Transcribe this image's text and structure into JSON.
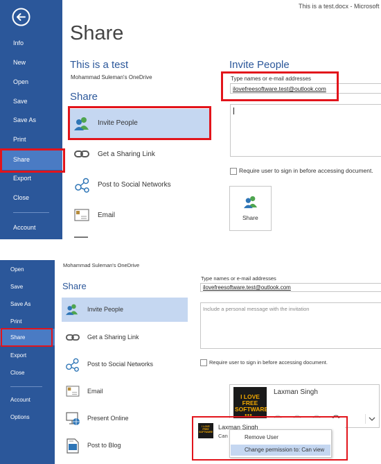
{
  "top": {
    "window_title": "This is a test.docx - Microsoft W",
    "back_icon": "back-arrow-icon",
    "nav": [
      "Info",
      "New",
      "Open",
      "Save",
      "Save As",
      "Print",
      "Share",
      "Export",
      "Close",
      "Account"
    ],
    "active_nav": "Share",
    "page_heading": "Share",
    "doc_title": "This is a test",
    "doc_location": "Mohammad Suleman's OneDrive",
    "share_section": "Share",
    "options": [
      "Invite People",
      "Get a Sharing Link",
      "Post to Social Networks",
      "Email"
    ],
    "selected_option": "Invite People",
    "invite_heading": "Invite People",
    "names_label": "Type names or e-mail addresses",
    "names_value": "ilovefreesoftware.test@outlook.com",
    "require_signin_label": "Require user to sign in before accessing document.",
    "share_button_label": "Share"
  },
  "bottom": {
    "nav": [
      "Open",
      "Save",
      "Save As",
      "Print",
      "Share",
      "Export",
      "Close",
      "Account",
      "Options"
    ],
    "active_nav": "Share",
    "doc_location": "Mohammad Suleman's OneDrive",
    "share_section": "Share",
    "options": [
      "Invite People",
      "Get a Sharing Link",
      "Post to Social Networks",
      "Email",
      "Present Online",
      "Post to Blog"
    ],
    "selected_option": "Invite People",
    "names_label": "Type names or e-mail addresses",
    "names_value": "ilovefreesoftware.test@outlook.com",
    "message_placeholder": "Include a personal message with the invitation",
    "require_signin_label": "Require user to sign in before accessing document.",
    "contact_card_name": "Laxman Singh",
    "contact_row_name": "Laxman Singh",
    "contact_row_sub": "Can",
    "avatar_text": "I LOVE FREE SOFTWARE",
    "context_menu": [
      "Remove User",
      "Change permission to: Can view"
    ]
  },
  "colors": {
    "sidebar": "#2b579a",
    "active_nav": "#4a7bc4",
    "accent": "#2b579a",
    "selected_option": "#c5d7f1",
    "annotation": "#e2141b"
  }
}
